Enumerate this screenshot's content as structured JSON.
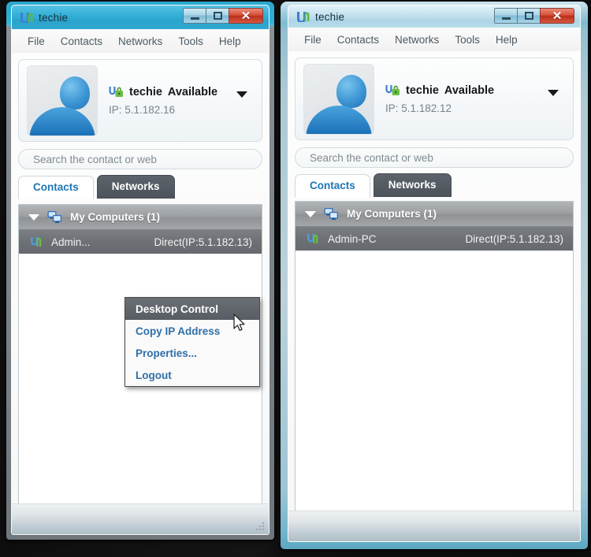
{
  "app": {
    "name": "techie",
    "icon": "app-logo-icon"
  },
  "colors": {
    "accent_blue": "#2aa8cf",
    "link_blue": "#2f6fa8",
    "tab_active_text": "#1f76b5",
    "tab_inactive_bg": "#4c535b",
    "close_button_red": "#b92f1b",
    "row_selected_bg": "#6d7175",
    "group_header_bg": "#9b9fa2"
  },
  "window_controls": {
    "minimize_label": "–",
    "maximize_label": "□",
    "close_label": "✕",
    "minimize_name": "minimize-button",
    "maximize_name": "maximize-button",
    "close_name": "close-button"
  },
  "menu": {
    "items": [
      {
        "label": "File"
      },
      {
        "label": "Contacts"
      },
      {
        "label": "Networks"
      },
      {
        "label": "Tools"
      },
      {
        "label": "Help"
      }
    ]
  },
  "left_window": {
    "title": "techie",
    "profile": {
      "name": "techie",
      "status": "Available",
      "ip_label": "IP: 5.1.182.16"
    },
    "search": {
      "placeholder": "Search the contact or web",
      "value": ""
    },
    "tabs": [
      {
        "label": "Contacts",
        "active": true
      },
      {
        "label": "Networks",
        "active": false
      }
    ],
    "group": {
      "label": "My Computers (1)",
      "expanded": true
    },
    "contacts": [
      {
        "name": "Admin...",
        "connection": "Direct(IP:5.1.182.13)",
        "selected": true
      }
    ],
    "context_menu": {
      "items": [
        {
          "label": "Desktop Control",
          "highlighted": true
        },
        {
          "label": "Copy IP Address",
          "highlighted": false
        },
        {
          "label": "Properties...",
          "highlighted": false
        },
        {
          "label": "Logout",
          "highlighted": false
        }
      ]
    }
  },
  "right_window": {
    "title": "techie",
    "profile": {
      "name": "techie",
      "status": "Available",
      "ip_label": "IP: 5.1.182.12"
    },
    "search": {
      "placeholder": "Search the contact or web",
      "value": ""
    },
    "tabs": [
      {
        "label": "Contacts",
        "active": true
      },
      {
        "label": "Networks",
        "active": false
      }
    ],
    "group": {
      "label": "My Computers (1)",
      "expanded": true
    },
    "contacts": [
      {
        "name": "Admin-PC",
        "connection": "Direct(IP:5.1.182.13)",
        "selected": true
      }
    ]
  }
}
